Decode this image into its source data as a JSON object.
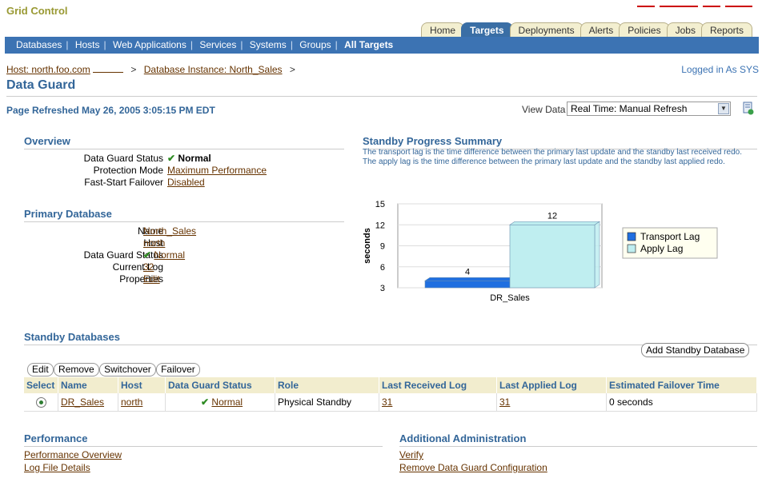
{
  "app": {
    "brand": "Grid Control"
  },
  "tabs": [
    {
      "label": "Home",
      "active": false
    },
    {
      "label": "Targets",
      "active": true
    },
    {
      "label": "Deployments",
      "active": false
    },
    {
      "label": "Alerts",
      "active": false
    },
    {
      "label": "Policies",
      "active": false
    },
    {
      "label": "Jobs",
      "active": false
    },
    {
      "label": "Reports",
      "active": false
    }
  ],
  "subnav": [
    "Databases",
    "Hosts",
    "Web Applications",
    "Services",
    "Systems",
    "Groups",
    "All Targets"
  ],
  "breadcrumb": {
    "host": "Host: north.foo.com",
    "sep1": ">",
    "instance": "Database Instance: North_Sales",
    "sep2": ">"
  },
  "logged_in": "Logged in As SYS",
  "page_title": "Data Guard",
  "refreshed": "Page Refreshed May 26, 2005 3:05:15 PM EDT",
  "view_data": {
    "label": "View Data",
    "value": "Real Time: Manual Refresh"
  },
  "overview": {
    "title": "Overview",
    "status_label": "Data Guard Status",
    "status_value": "Normal",
    "protection_label": "Protection Mode",
    "protection_value": "Maximum Performance",
    "failover_label": "Fast-Start Failover",
    "failover_value": "Disabled"
  },
  "primary": {
    "title": "Primary Database",
    "name_label": "Name",
    "name_value": "North_Sales",
    "host_label": "Host",
    "host_value": "north",
    "status_label": "Data Guard Status",
    "status_value": "Normal",
    "log_label": "Current Log",
    "log_value": "32",
    "props_label": "Properties",
    "props_value": "Edit"
  },
  "standby_summary": {
    "title": "Standby Progress Summary",
    "description": "The transport lag is the time difference between the primary last update and the standby last received redo. The apply lag is the time difference between the primary last update and the standby last applied redo."
  },
  "chart_data": {
    "type": "bar",
    "categories": [
      "DR_Sales"
    ],
    "series": [
      {
        "name": "Transport Lag",
        "values": [
          4
        ],
        "color": "#1f6fe0"
      },
      {
        "name": "Apply Lag",
        "values": [
          12
        ],
        "color": "#bfeef0"
      }
    ],
    "ylabel": "seconds",
    "yticks": [
      3,
      6,
      9,
      12,
      15
    ],
    "ylim": [
      3,
      15
    ],
    "legend": "right",
    "grid": true
  },
  "standby": {
    "title": "Standby Databases",
    "add_button": "Add Standby Database",
    "actions": [
      "Edit",
      "Remove",
      "Switchover",
      "Failover"
    ],
    "columns": [
      "Select",
      "Name",
      "Host",
      "Data Guard Status",
      "Role",
      "Last Received Log",
      "Last Applied Log",
      "Estimated Failover Time"
    ],
    "rows": [
      {
        "name": "DR_Sales",
        "host": "north",
        "status": "Normal",
        "role": "Physical Standby",
        "received": "31",
        "applied": "31",
        "failover": "0 seconds"
      }
    ]
  },
  "performance": {
    "title": "Performance",
    "links": [
      "Performance Overview",
      "Log File Details"
    ]
  },
  "admin": {
    "title": "Additional Administration",
    "links": [
      "Verify",
      "Remove Data Guard Configuration"
    ]
  },
  "colors": {
    "accent": "#336699",
    "nav": "#3c73b3",
    "link": "#663300",
    "ok": "#2e8b22"
  }
}
